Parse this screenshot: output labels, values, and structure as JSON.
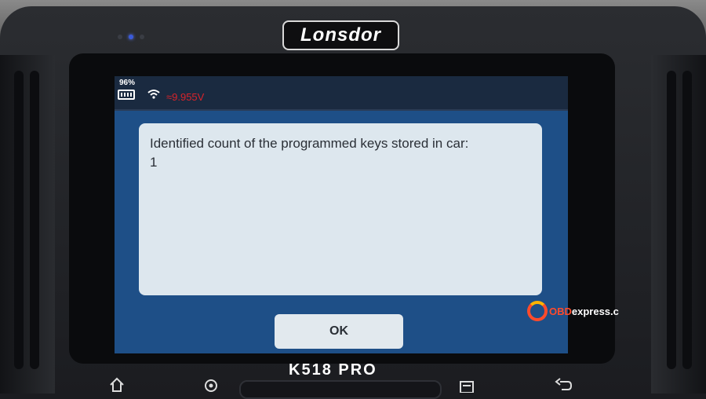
{
  "device": {
    "brand": "Lonsdor",
    "model": "K518 PRO"
  },
  "statusbar": {
    "battery_percent": "96%",
    "voltage": "≈9.955V"
  },
  "dialog": {
    "message_line1": "Identified count of the programmed keys stored in car:",
    "message_line2": "1",
    "ok_label": "OK"
  },
  "watermark": {
    "prefix": "OBD",
    "suffix": "express.c"
  },
  "colors": {
    "screen_bg": "#1e4f87",
    "dialog_bg": "#dde7ee",
    "voltage_red": "#d8232a"
  }
}
